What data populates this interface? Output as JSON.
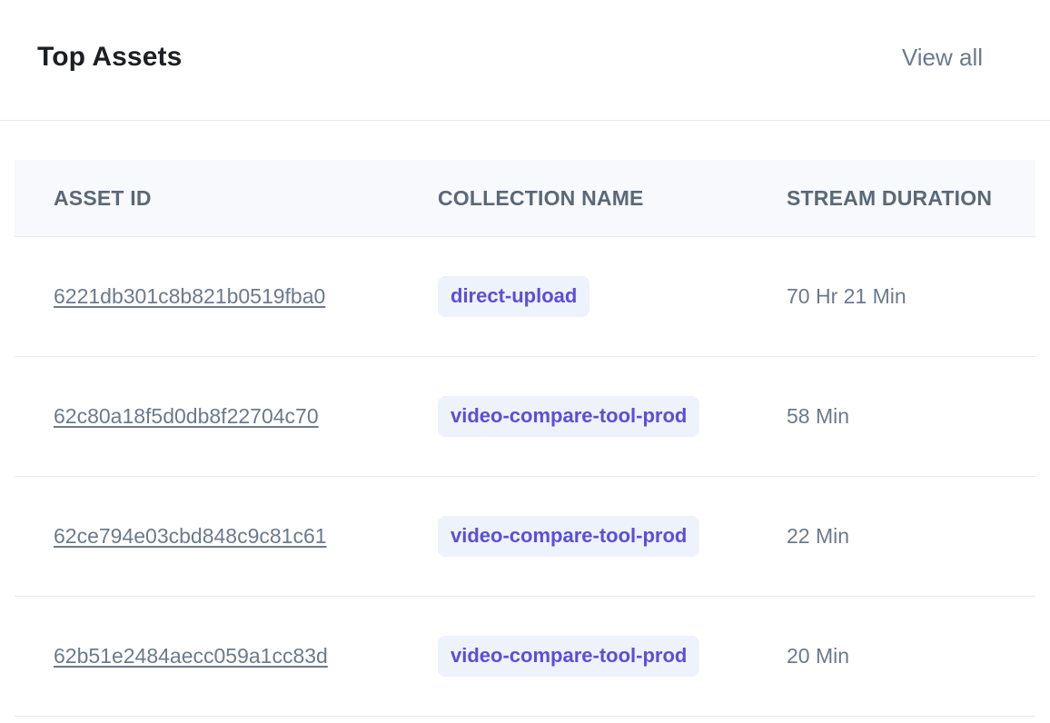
{
  "header": {
    "title": "Top Assets",
    "view_all_label": "View all"
  },
  "table": {
    "columns": [
      "ASSET ID",
      "COLLECTION NAME",
      "STREAM DURATION"
    ],
    "rows": [
      {
        "asset_id": "6221db301c8b821b0519fba0",
        "collection": "direct-upload",
        "duration": "70 Hr 21 Min"
      },
      {
        "asset_id": "62c80a18f5d0db8f22704c70",
        "collection": "video-compare-tool-prod",
        "duration": "58 Min"
      },
      {
        "asset_id": "62ce794e03cbd848c9c81c61",
        "collection": "video-compare-tool-prod",
        "duration": "22 Min"
      },
      {
        "asset_id": "62b51e2484aecc059a1cc83d",
        "collection": "video-compare-tool-prod",
        "duration": "20 Min"
      }
    ]
  },
  "colors": {
    "pill_background": "#eef2fb",
    "pill_text": "#5a4fd8",
    "muted_text": "#6b7a8c",
    "header_background": "#f7f9fc"
  }
}
